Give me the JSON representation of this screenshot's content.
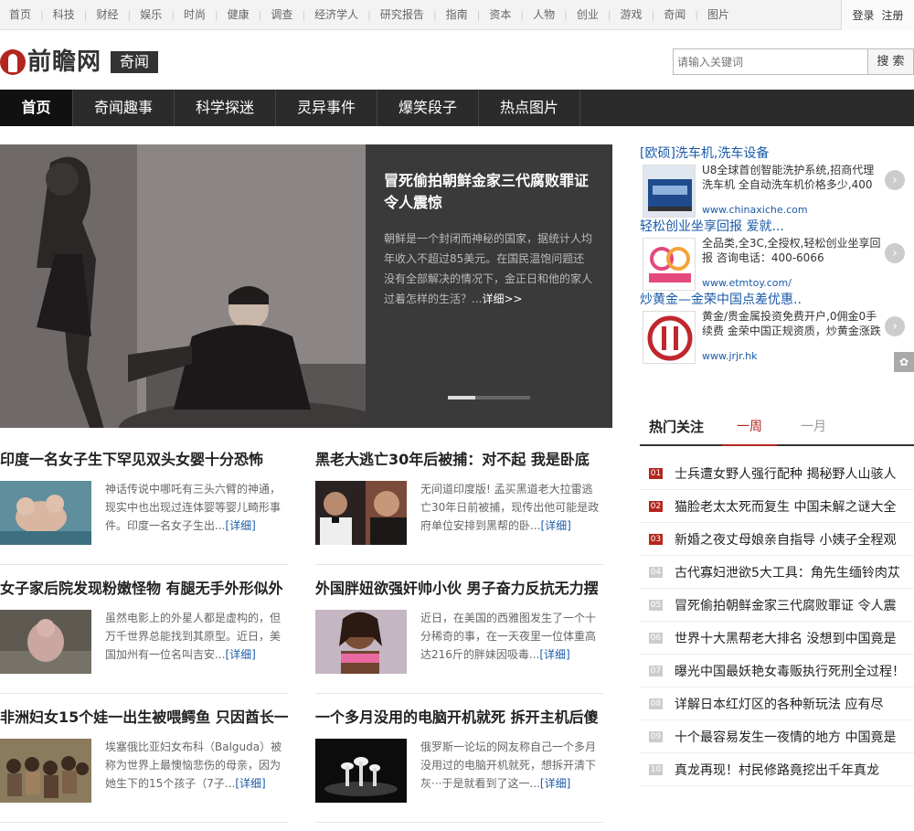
{
  "top_nav": [
    "首页",
    "科技",
    "财经",
    "娱乐",
    "时尚",
    "健康",
    "调查",
    "经济学人",
    "研究报告",
    "指南",
    "资本",
    "人物",
    "创业",
    "游戏",
    "奇闻",
    "图片"
  ],
  "auth": {
    "login": "登录",
    "register": "注册"
  },
  "logo": {
    "text": "前瞻网",
    "channel": "奇闻"
  },
  "search": {
    "placeholder": "请输入关键词",
    "button": "搜 索"
  },
  "main_nav": [
    "首页",
    "奇闻趣事",
    "科学探迷",
    "灵异事件",
    "爆笑段子",
    "热点图片"
  ],
  "hero": {
    "title": "冒死偷拍朝鲜金家三代腐败罪证 令人震惊",
    "desc": "朝鲜是一个封闭而神秘的国家，据统计人均年收入不超过85美元。在国民温饱问题还没有全部解决的情况下，金正日和他的家人过着怎样的生活？...",
    "more": "详细>>"
  },
  "articles": [
    {
      "title": "印度一名女子生下罕见双头女婴十分恐怖",
      "desc": "神话传说中哪吒有三头六臂的神通，现实中也出现过连体婴等婴儿畸形事件。印度一名女子生出...",
      "more": "[详细]"
    },
    {
      "title": "黑老大逃亡30年后被捕：对不起 我是卧底",
      "desc": "无间道印度版! 孟买黑道老大拉雷逃亡30年日前被捕，现传出他可能是政府单位安排到黑帮的卧...",
      "more": "[详细]"
    },
    {
      "title": "女子家后院发现粉嫩怪物 有腿无手外形似外",
      "desc": "虽然电影上的外星人都是虚构的，但万千世界总能找到其原型。近日，美国加州有一位名叫吉安...",
      "more": "[详细]"
    },
    {
      "title": "外国胖妞欲强奸帅小伙 男子奋力反抗无力摆",
      "desc": "近日，在美国的西雅图发生了一个十分稀奇的事，在一天夜里一位体重高达216斤的胖妹因吸毒...",
      "more": "[详细]"
    },
    {
      "title": "非洲妇女15个娃一出生被喂鳄鱼 只因酋长一",
      "desc": "埃塞俄比亚妇女布科（Balguda）被称为世界上最懊恼悲伤的母亲，因为她生下的15个孩子（7子...",
      "more": "[详细]"
    },
    {
      "title": "一个多月没用的电脑开机就死 拆开主机后傻",
      "desc": "俄罗斯一论坛的网友称自己一个多月没用过的电脑开机就死，想拆开清下灰···于是就看到了这一...",
      "more": "[详细]"
    }
  ],
  "ads": [
    {
      "title": "[欧硕]洗车机,洗车设备",
      "desc": "U8全球首创智能洗护系统,招商代理洗车机 全自动洗车机价格多少,400",
      "url": "www.chinaxiche.com"
    },
    {
      "title": "轻松创业坐享回报 爱就...",
      "desc": "全品类,全3C,全授权,轻松创业坐享回报 咨询电话：400-6066",
      "url": "www.etmtoy.com/"
    },
    {
      "title": "炒黄金—金荣中国点差优惠..",
      "desc": "黄金/贵金属投资免费开户,0佣金0手续费 金荣中国正规资质，炒黄金涨跌",
      "url": "www.jrjr.hk"
    }
  ],
  "hot": {
    "title": "热门关注",
    "tabs": [
      "一周",
      "一月"
    ],
    "items": [
      {
        "rank": "01",
        "text": "士兵遭女野人强行配种 揭秘野人山骇人"
      },
      {
        "rank": "02",
        "text": "猫脸老太太死而复生 中国未解之谜大全"
      },
      {
        "rank": "03",
        "text": "新婚之夜丈母娘亲自指导 小姨子全程观"
      },
      {
        "rank": "04",
        "text": "古代寡妇泄欲5大工具：角先生缅铃肉苁"
      },
      {
        "rank": "05",
        "text": "冒死偷拍朝鲜金家三代腐败罪证 令人震"
      },
      {
        "rank": "06",
        "text": "世界十大黑帮老大排名 没想到中国竟是"
      },
      {
        "rank": "07",
        "text": "曝光中国最妖艳女毒贩执行死刑全过程！"
      },
      {
        "rank": "08",
        "text": "详解日本红灯区的各种新玩法 应有尽"
      },
      {
        "rank": "09",
        "text": "十个最容易发生一夜情的地方 中国竟是"
      },
      {
        "rank": "10",
        "text": "真龙再现！村民修路竟挖出千年真龙"
      }
    ]
  }
}
